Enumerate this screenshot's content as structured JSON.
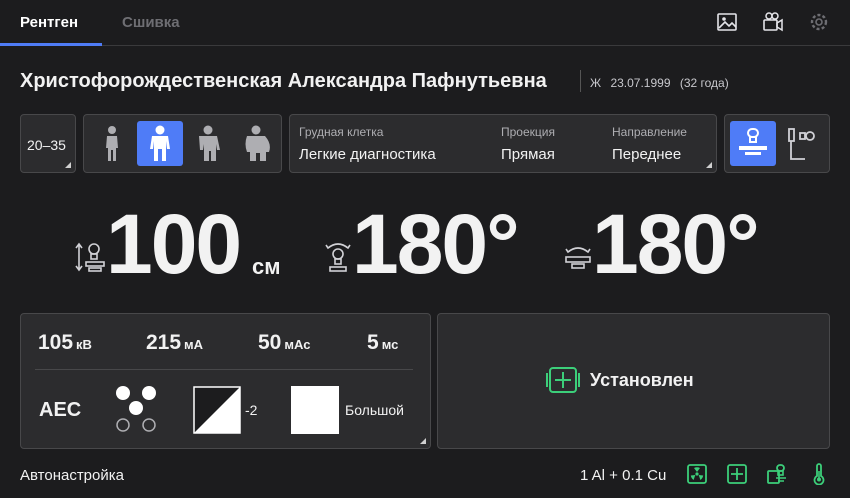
{
  "tabs": [
    {
      "label": "Рентген"
    },
    {
      "label": "Сшивка"
    }
  ],
  "top_icons": [
    "image-icon",
    "video-camera-icon",
    "settings-gear-icon"
  ],
  "patient": {
    "name": "Христофорождественская Александра Пафнутьевна",
    "sex": "Ж",
    "birth_date": "23.07.1999",
    "age": "(32 года)"
  },
  "age_group": {
    "label": "20–35"
  },
  "body_types": {
    "options": [
      "slim-body-icon",
      "normal-body-icon",
      "large-body-icon",
      "obese-body-icon"
    ],
    "selected_index": 1
  },
  "exam": {
    "region_label": "Грудная клетка",
    "region_value": "Легкие диагностика",
    "projection_label": "Проекция",
    "projection_value": "Прямая",
    "direction_label": "Направление",
    "direction_value": "Переднее"
  },
  "position_mode": {
    "options": [
      "table-detector-icon",
      "wall-stand-icon"
    ],
    "selected_index": 0
  },
  "geometry": {
    "distance_value": "100",
    "distance_unit": "см",
    "tube_angle_value": "180°",
    "detector_angle_value": "180°"
  },
  "exposure": {
    "kv_value": "105",
    "kv_unit": "кВ",
    "ma_value": "215",
    "ma_unit": "мА",
    "mas_value": "50",
    "mas_unit": "мАс",
    "ms_value": "5",
    "ms_unit": "мс",
    "aec_label": "AEC",
    "density_value": "-2",
    "focus_label": "Большой"
  },
  "detector_status": {
    "label": "Установлен"
  },
  "footer": {
    "left_label": "Автонастройка",
    "filter_label": "1 Al + 0.1 Cu",
    "icons": [
      "radiation-icon",
      "grid-icon",
      "detector-icon",
      "temperature-icon"
    ]
  },
  "colors": {
    "accent": "#4f7cf7",
    "status_green": "#3ccf7a",
    "background": "#1c1c1e",
    "panel": "#2c2c2e"
  }
}
